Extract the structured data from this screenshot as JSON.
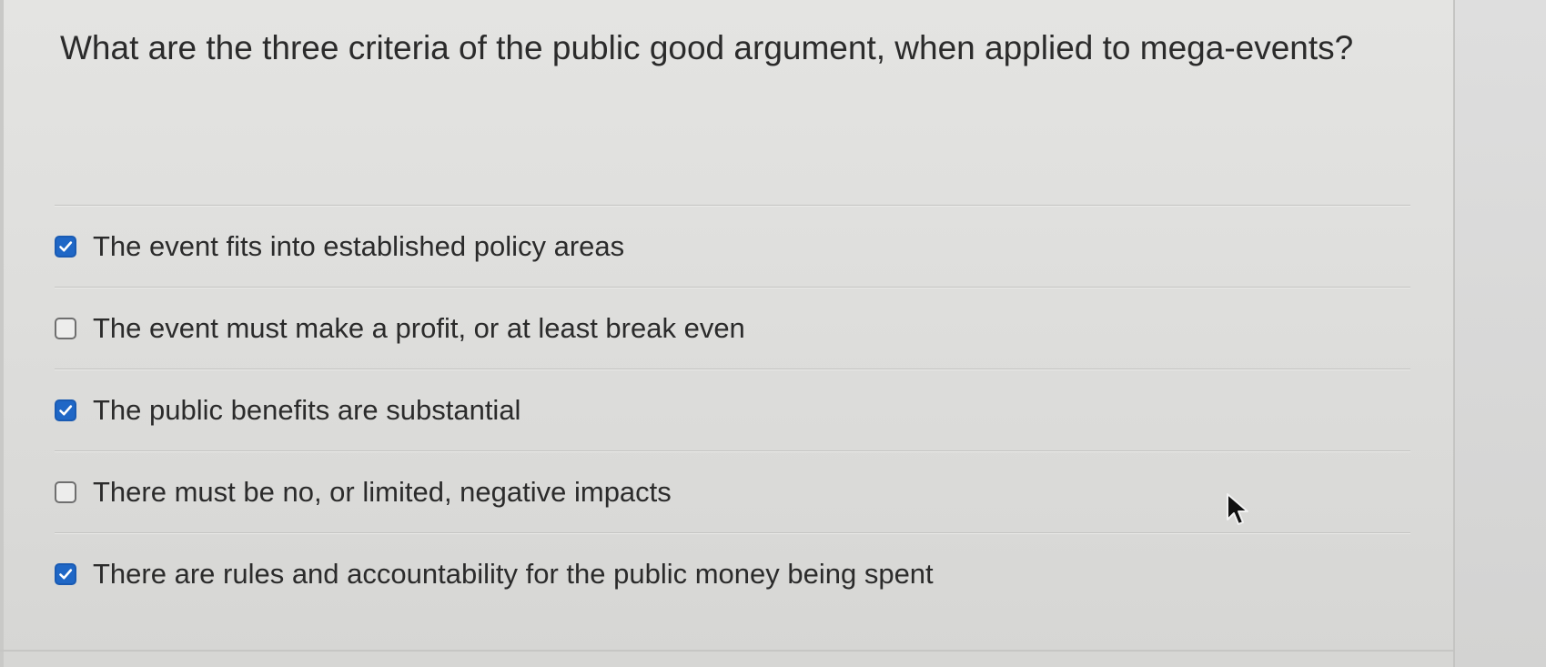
{
  "question": {
    "text": "What are the three criteria of the public good argument, when applied to mega-events?"
  },
  "options": [
    {
      "label": "The event fits into established policy areas",
      "checked": true
    },
    {
      "label": "The event must make a profit, or at least break even",
      "checked": false
    },
    {
      "label": "The public benefits are substantial",
      "checked": true
    },
    {
      "label": "There must be no, or limited, negative impacts",
      "checked": false
    },
    {
      "label": "There are rules and accountability for the public money being spent",
      "checked": true
    }
  ],
  "colors": {
    "checkbox_checked": "#1f67c6",
    "text": "#2b2b2b",
    "background": "#e0e0de"
  },
  "icons": {
    "check": "check-icon",
    "cursor": "mouse-pointer-icon"
  }
}
